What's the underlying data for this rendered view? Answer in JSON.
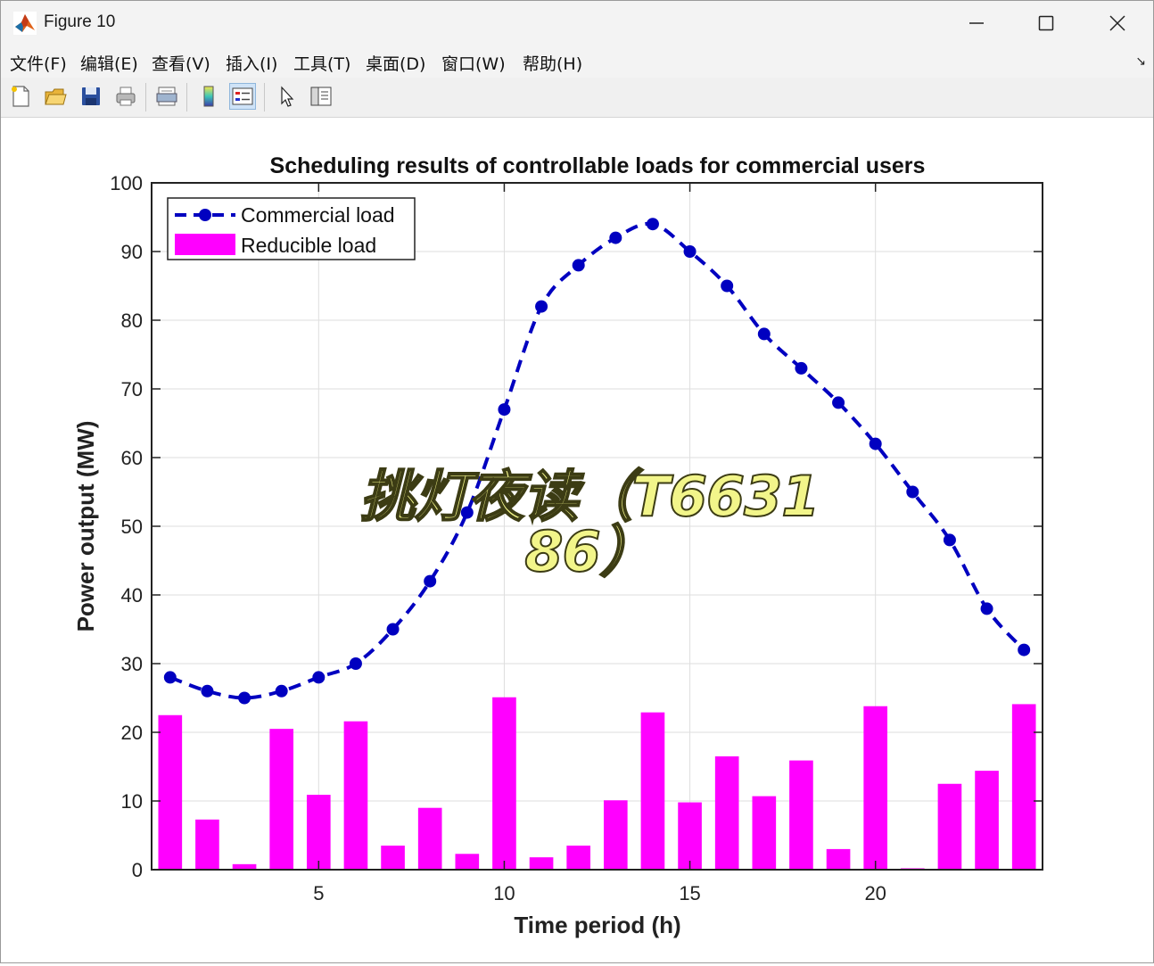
{
  "window": {
    "title": "Figure 10"
  },
  "menu": [
    "文件(F)",
    "编辑(E)",
    "查看(V)",
    "插入(I)",
    "工具(T)",
    "桌面(D)",
    "窗口(W)",
    "帮助(H)"
  ],
  "toolbar": {
    "icons": [
      "new-figure-icon",
      "open-file-icon",
      "save-icon",
      "print-icon",
      "print-preview-icon",
      "colorbar-icon",
      "legend-icon",
      "pointer-icon",
      "property-editor-icon"
    ]
  },
  "watermark": {
    "line1": "挑灯夜读（T6631",
    "line2": "86）"
  },
  "chart_data": {
    "type": "bar",
    "title": "Scheduling results of controllable loads for commercial users",
    "xlabel": "Time period (h)",
    "ylabel": "Power output (MW)",
    "xlim": [
      0.5,
      24.5
    ],
    "ylim": [
      0,
      100
    ],
    "xticks": [
      5,
      10,
      15,
      20
    ],
    "yticks": [
      0,
      10,
      20,
      30,
      40,
      50,
      60,
      70,
      80,
      90,
      100
    ],
    "grid": true,
    "legend_location": "top-left",
    "x": [
      1,
      2,
      3,
      4,
      5,
      6,
      7,
      8,
      9,
      10,
      11,
      12,
      13,
      14,
      15,
      16,
      17,
      18,
      19,
      20,
      21,
      22,
      23,
      24
    ],
    "series": [
      {
        "name": "Commercial load",
        "kind": "line",
        "style": "dashed-with-dots",
        "color": "#0000c0",
        "values": [
          28,
          26,
          25,
          26,
          28,
          30,
          35,
          42,
          52,
          67,
          82,
          88,
          92,
          94,
          90,
          85,
          78,
          73,
          68,
          62,
          55,
          48,
          38,
          32
        ]
      },
      {
        "name": "Reducible load",
        "kind": "bar",
        "color": "#ff00ff",
        "values": [
          22.5,
          7.3,
          0.8,
          20.5,
          10.9,
          21.6,
          3.5,
          9.0,
          2.3,
          25.1,
          1.8,
          3.5,
          10.1,
          22.9,
          9.8,
          16.5,
          10.7,
          15.9,
          3.0,
          23.8,
          0.2,
          12.5,
          14.4,
          24.1
        ]
      }
    ]
  }
}
